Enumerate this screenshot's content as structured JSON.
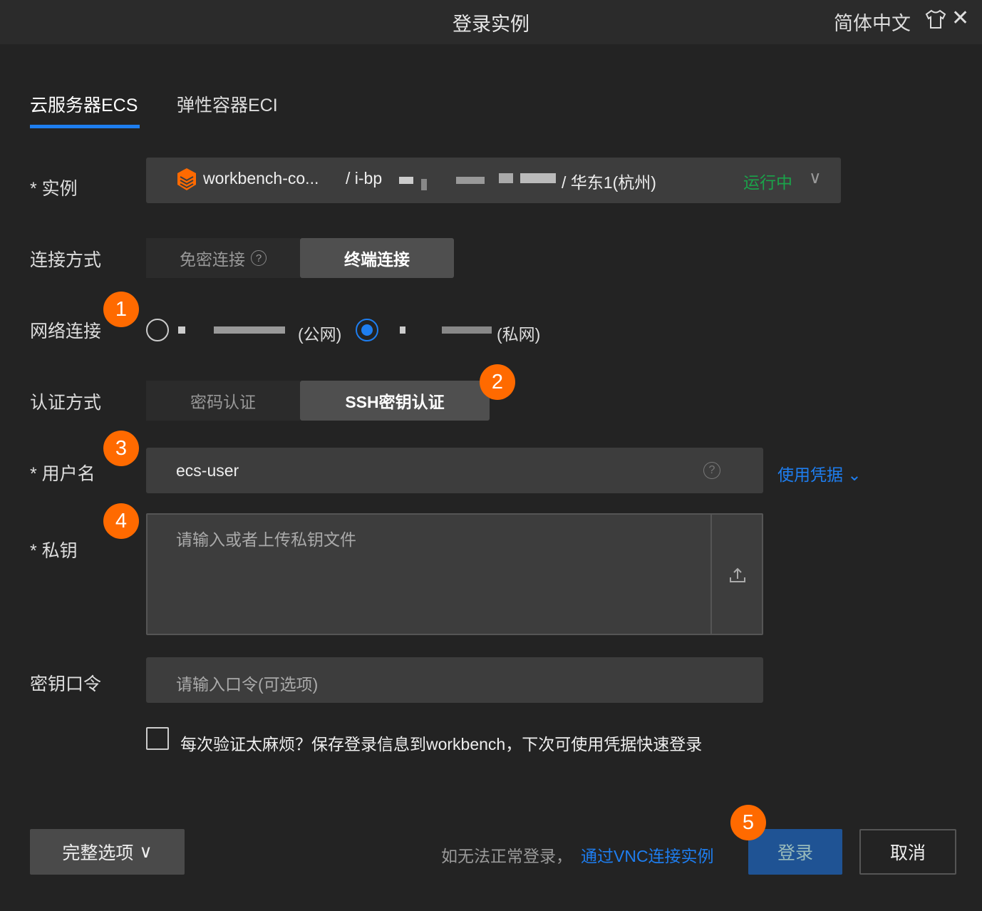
{
  "header": {
    "title": "登录实例",
    "language": "简体中文"
  },
  "tabs": [
    {
      "label": "云服务器ECS"
    },
    {
      "label": "弹性容器ECI"
    }
  ],
  "instance": {
    "label": "* 实例",
    "name": "workbench-co...",
    "id_prefix": "/ i-bp",
    "region": "/ 华东1(杭州)",
    "status": "运行中",
    "status_color": "#1aa34a"
  },
  "connection": {
    "label": "连接方式",
    "options": [
      "免密连接",
      "终端连接"
    ],
    "selected": "终端连接"
  },
  "network": {
    "label": "网络连接",
    "public": "(公网)",
    "private": "(私网)",
    "selected": "private"
  },
  "auth": {
    "label": "认证方式",
    "options": [
      "密码认证",
      "SSH密钥认证"
    ],
    "selected": "SSH密钥认证"
  },
  "username": {
    "label": "* 用户名",
    "value": "ecs-user",
    "credential_link": "使用凭据"
  },
  "private_key": {
    "label": "* 私钥",
    "placeholder": "请输入或者上传私钥文件"
  },
  "passphrase": {
    "label": "密钥口令",
    "placeholder": "请输入口令(可选项)"
  },
  "save_checkbox": {
    "label": "每次验证太麻烦？保存登录信息到workbench，下次可使用凭据快速登录",
    "checked": false
  },
  "footer": {
    "more_options": "完整选项",
    "hint": "如无法正常登录，",
    "vnc_link": "通过VNC连接实例",
    "login": "登录",
    "cancel": "取消"
  },
  "badges": [
    "1",
    "2",
    "3",
    "4",
    "5"
  ]
}
